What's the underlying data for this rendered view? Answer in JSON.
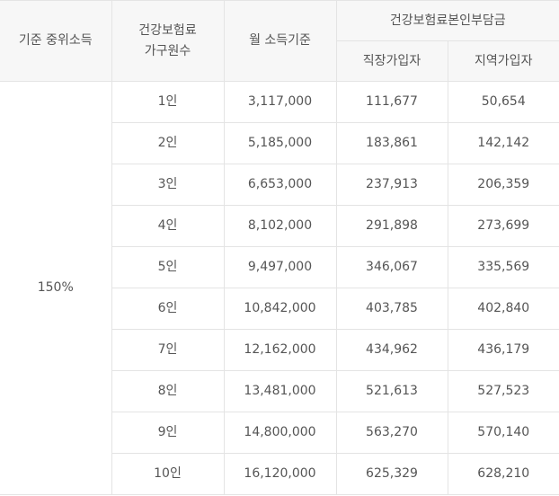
{
  "header": {
    "median_income": "기준 중위소득",
    "household_line1": "건강보험료",
    "household_line2": "가구원수",
    "monthly_income": "월 소득기준",
    "premium_group": "건강보험료본인부담금",
    "employee": "직장가입자",
    "regional": "지역가입자"
  },
  "median_percent": "150%",
  "rows": [
    {
      "household": "1인",
      "income": "3,117,000",
      "employee": "111,677",
      "regional": "50,654"
    },
    {
      "household": "2인",
      "income": "5,185,000",
      "employee": "183,861",
      "regional": "142,142"
    },
    {
      "household": "3인",
      "income": "6,653,000",
      "employee": "237,913",
      "regional": "206,359"
    },
    {
      "household": "4인",
      "income": "8,102,000",
      "employee": "291,898",
      "regional": "273,699"
    },
    {
      "household": "5인",
      "income": "9,497,000",
      "employee": "346,067",
      "regional": "335,569"
    },
    {
      "household": "6인",
      "income": "10,842,000",
      "employee": "403,785",
      "regional": "402,840"
    },
    {
      "household": "7인",
      "income": "12,162,000",
      "employee": "434,962",
      "regional": "436,179"
    },
    {
      "household": "8인",
      "income": "13,481,000",
      "employee": "521,613",
      "regional": "527,523"
    },
    {
      "household": "9인",
      "income": "14,800,000",
      "employee": "563,270",
      "regional": "570,140"
    },
    {
      "household": "10인",
      "income": "16,120,000",
      "employee": "625,329",
      "regional": "628,210"
    }
  ]
}
